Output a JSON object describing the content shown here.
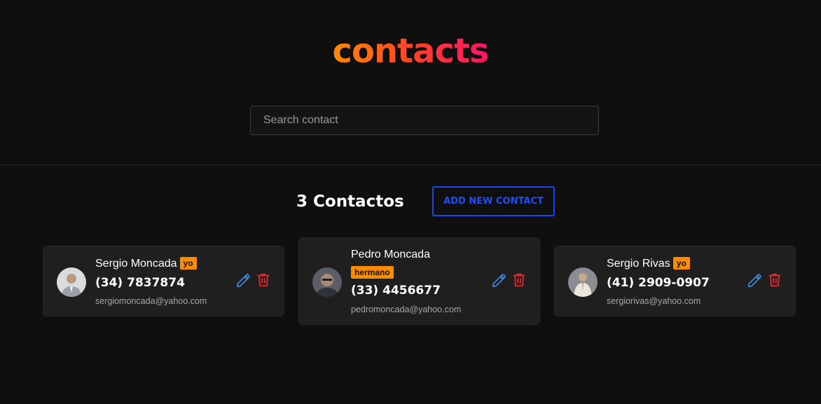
{
  "app": {
    "title": "contacts"
  },
  "search": {
    "placeholder": "Search contact",
    "value": ""
  },
  "toolbar": {
    "count_label": "3 Contactos",
    "add_label": "ADD NEW CONTACT"
  },
  "colors": {
    "background": "#0f0f10",
    "card": "#1f1f20",
    "accent_blue": "#1f4ef7",
    "tag": "#ff8c00",
    "edit": "#3d8fe0",
    "delete": "#e8262d"
  },
  "contacts": [
    {
      "name": "Sergio Moncada",
      "tag": "yo",
      "phone": "(34) 7837874",
      "email": "sergiomoncada@yahoo.com",
      "avatar_icon": "person-photo-icon"
    },
    {
      "name": "Pedro Moncada",
      "tag": "hermano",
      "phone": "(33) 4456677",
      "email": "pedromoncada@yahoo.com",
      "avatar_icon": "person-photo-icon"
    },
    {
      "name": "Sergio Rivas",
      "tag": "yo",
      "phone": "(41) 2909-0907",
      "email": "sergiorivas@yahoo.com",
      "avatar_icon": "person-photo-icon"
    }
  ]
}
